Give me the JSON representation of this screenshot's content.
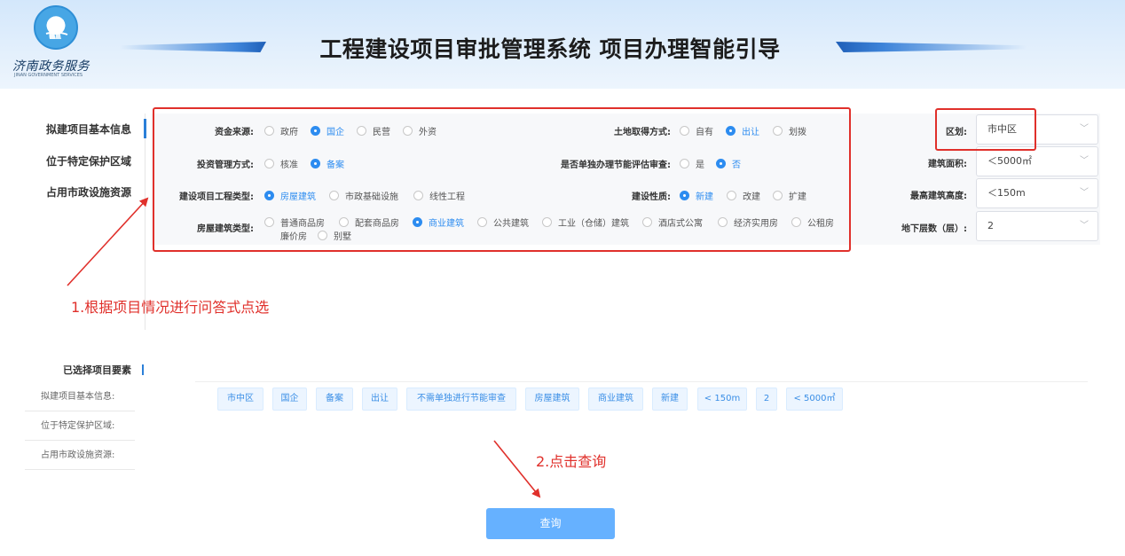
{
  "header": {
    "logo_cn": "济南政务服务",
    "logo_en": "JINAN GOVERNMENT SERVICES",
    "title": "工程建设项目审批管理系统 项目办理智能引导"
  },
  "nav": {
    "items": [
      "拟建项目基本信息",
      "位于特定保护区域",
      "占用市政设施资源"
    ]
  },
  "form": {
    "funding": {
      "label": "资金来源:",
      "options": [
        "政府",
        "国企",
        "民营",
        "外资"
      ],
      "selected": "国企"
    },
    "land": {
      "label": "土地取得方式:",
      "options": [
        "自有",
        "出让",
        "划拨"
      ],
      "selected": "出让"
    },
    "invest": {
      "label": "投资管理方式:",
      "options": [
        "核准",
        "备案"
      ],
      "selected": "备案"
    },
    "energy": {
      "label": "是否单独办理节能评估审查:",
      "options": [
        "是",
        "否"
      ],
      "selected": "否"
    },
    "project_type": {
      "label": "建设项目工程类型:",
      "options": [
        "房屋建筑",
        "市政基础设施",
        "线性工程"
      ],
      "selected": "房屋建筑"
    },
    "build_nature": {
      "label": "建设性质:",
      "options": [
        "新建",
        "改建",
        "扩建"
      ],
      "selected": "新建"
    },
    "house_type": {
      "label": "房屋建筑类型:",
      "options": [
        "普通商品房",
        "配套商品房",
        "商业建筑",
        "公共建筑",
        "工业（仓储）建筑",
        "酒店式公寓",
        "经济实用房",
        "公租房",
        "廉价房",
        "别墅"
      ],
      "selected": "商业建筑"
    }
  },
  "selects": {
    "district": {
      "label": "区划:",
      "value": "市中区"
    },
    "area": {
      "label": "建筑面积:",
      "value": "＜5000㎡"
    },
    "height": {
      "label": "最高建筑高度:",
      "value": "＜150m"
    },
    "floors": {
      "label": "地下层数（层）:",
      "value": "2"
    }
  },
  "annotations": {
    "step1": "1.根据项目情况进行问答式点选",
    "step2": "2.点击查询"
  },
  "selected_section": {
    "title": "已选择项目要素",
    "sub_items": [
      "拟建项目基本信息:",
      "位于特定保护区域:",
      "占用市政设施资源:"
    ],
    "tags": [
      "市中区",
      "国企",
      "备案",
      "出让",
      "不需单独进行节能审查",
      "房屋建筑",
      "商业建筑",
      "新建",
      "< 150m",
      "2",
      "< 5000㎡"
    ]
  },
  "query_button": "查询",
  "colors": {
    "accent": "#2d8cf0",
    "annotation_red": "#e0302b",
    "button": "#66b1ff"
  }
}
